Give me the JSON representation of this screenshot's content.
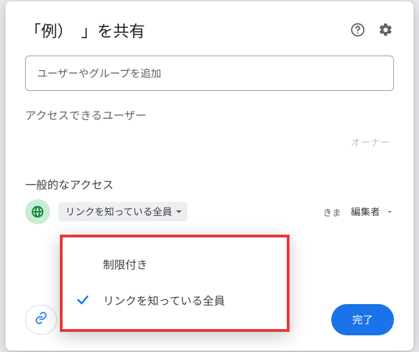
{
  "dialog": {
    "title": "「例）　」を共有",
    "add_placeholder": "ユーザーやグループを追加",
    "access_label": "アクセスできるユーザー",
    "owner_label": "オーナー",
    "general_label": "一般的なアクセス",
    "access_mode": "リンクを知っている全員",
    "role_note": "きま",
    "role": "編集者",
    "done": "完了"
  },
  "dropdown": {
    "options": [
      {
        "label": "制限付き",
        "selected": false
      },
      {
        "label": "リンクを知っている全員",
        "selected": true
      }
    ]
  },
  "icons": {
    "help": "help-icon",
    "settings": "gear-icon",
    "globe": "globe-icon",
    "link": "link-icon",
    "caret": "caret-down-icon",
    "check": "check-icon"
  }
}
